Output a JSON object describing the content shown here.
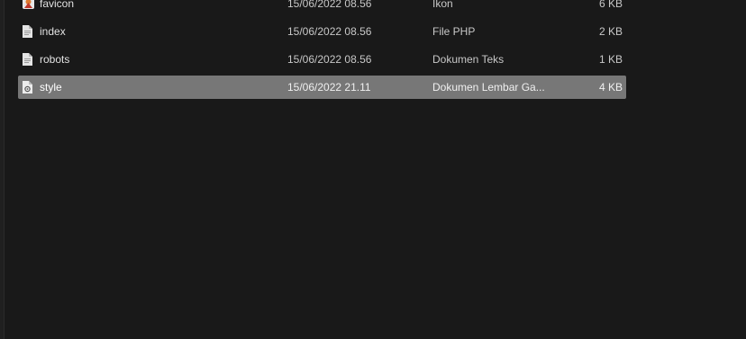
{
  "files": [
    {
      "name": "favicon",
      "date": "15/06/2022 08.56",
      "type": "Ikon",
      "size": "6 KB",
      "icon": "favicon-icon"
    },
    {
      "name": "index",
      "date": "15/06/2022 08.56",
      "type": "File PHP",
      "size": "2 KB",
      "icon": "document-icon"
    },
    {
      "name": "robots",
      "date": "15/06/2022 08.56",
      "type": "Dokumen Teks",
      "size": "1 KB",
      "icon": "document-icon"
    },
    {
      "name": "style",
      "date": "15/06/2022 21.11",
      "type": "Dokumen Lembar Ga...",
      "size": "4 KB",
      "icon": "stylesheet-icon",
      "selected": true
    }
  ]
}
